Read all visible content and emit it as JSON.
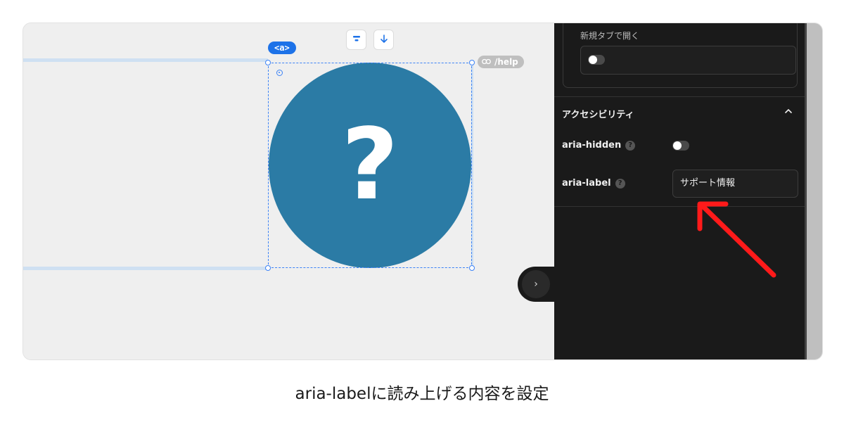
{
  "canvas": {
    "element_tag": "<a>",
    "link_href": "/help",
    "toolbar_icons": [
      "align-icon",
      "arrow-down-icon"
    ],
    "circle_color": "#2b7ba5",
    "icon_glyph": "?"
  },
  "panel": {
    "open_new_tab_label": "新規タブで開く",
    "open_new_tab_enabled": false,
    "accessibility_section_title": "アクセシビリティ",
    "aria_hidden_label": "aria-hidden",
    "aria_hidden_enabled": false,
    "aria_label_label": "aria-label",
    "aria_label_value": "サポート情報"
  },
  "annotation": {
    "arrow_color": "#ff1a1a"
  },
  "caption": "aria-labelに読み上げる内容を設定",
  "colors": {
    "selection": "#3b82f6",
    "panel_bg": "#1a1a1a",
    "tag_bg": "#1d72e8"
  }
}
